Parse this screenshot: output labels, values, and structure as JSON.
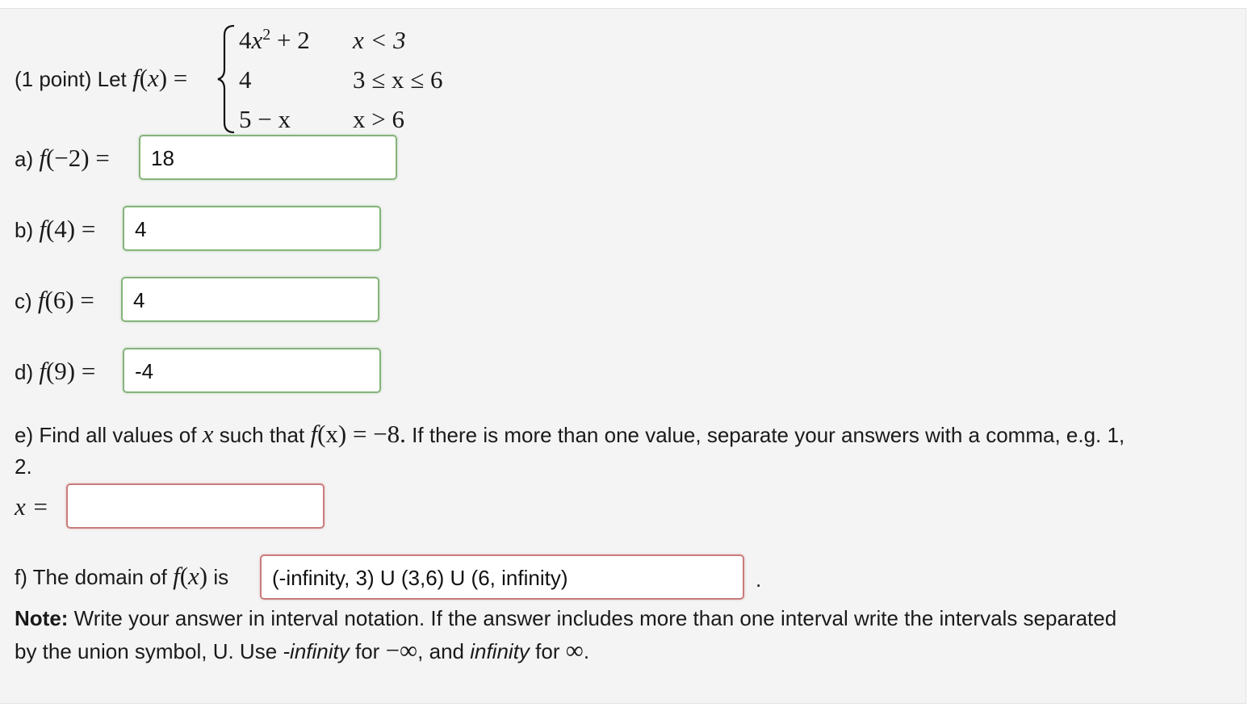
{
  "problem": {
    "points_label": "(1 point) Let",
    "func": "f",
    "var": "x",
    "pieces": [
      {
        "expr_a": "4",
        "expr_b": "x",
        "expr_sup": "2",
        "expr_c": " + 2",
        "cond": "x < 3"
      },
      {
        "expr": "4",
        "cond": "3 ≤ x ≤ 6"
      },
      {
        "expr": "5 − x",
        "cond": "x > 6"
      }
    ]
  },
  "parts": {
    "a": {
      "label": "a)",
      "arg": "(−2) =",
      "value": "18",
      "status": "correct"
    },
    "b": {
      "label": "b)",
      "arg": "(4) =",
      "value": "4",
      "status": "correct"
    },
    "c": {
      "label": "c)",
      "arg": "(6) =",
      "value": "4",
      "status": "correct"
    },
    "d": {
      "label": "d)",
      "arg": "(9) =",
      "value": "-4",
      "status": "correct"
    },
    "e": {
      "text1": "e) Find all values of",
      "text2": "such that",
      "eq": "(x) = −8.",
      "text3": "If there is more than one value, separate your answers with a comma, e.g. 1,",
      "text4": "2.",
      "x_label": "x =",
      "value": "",
      "status": "incorrect"
    },
    "f": {
      "text1": "f) The domain of",
      "text2": "is",
      "value": "(-infinity, 3) U (3,6) U (6, infinity)",
      "period": ".",
      "status": "incorrect"
    }
  },
  "note": {
    "bold": "Note:",
    "line1": "Write your answer in interval notation. If the answer includes more than one interval write the intervals separated",
    "line2a": "by the union symbol, U. Use",
    "neg_inf_word": "-infinity",
    "line2b": "for",
    "neg_inf_sym": "−∞",
    "line2c": ", and",
    "inf_word": "infinity",
    "line2d": "for",
    "inf_sym": "∞",
    "line2e": "."
  },
  "colors": {
    "correct_border": "#84b37a",
    "incorrect_border": "#c97c7c",
    "panel_bg": "#f4f4f4"
  }
}
